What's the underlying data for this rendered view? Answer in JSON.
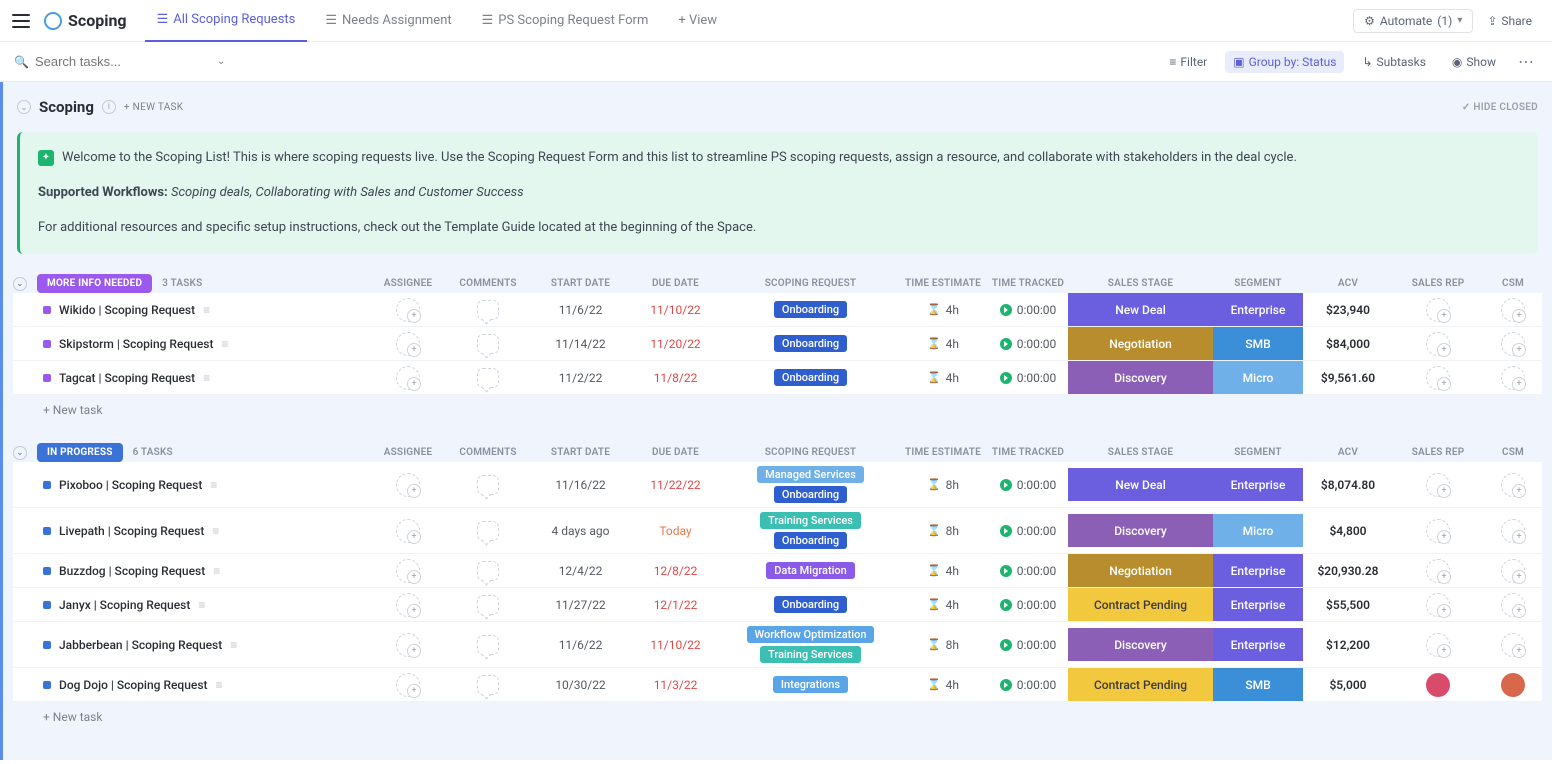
{
  "app": {
    "title": "Scoping",
    "tabs": [
      {
        "label": "All Scoping Requests",
        "active": true
      },
      {
        "label": "Needs Assignment"
      },
      {
        "label": "PS Scoping Request Form"
      }
    ],
    "add_view": "+ View",
    "automate": {
      "label": "Automate",
      "count": "(1)"
    },
    "share": "Share"
  },
  "filters": {
    "search_placeholder": "Search tasks...",
    "filter": "Filter",
    "group_by": "Group by: Status",
    "subtasks": "Subtasks",
    "show": "Show"
  },
  "section": {
    "title": "Scoping",
    "new_task": "+ NEW TASK",
    "hide_closed": "✓ HIDE CLOSED"
  },
  "banner": {
    "line1": "Welcome to the Scoping List! This is where scoping requests live. Use the Scoping Request Form and this list to streamline PS scoping requests, assign a resource, and collaborate with stakeholders in the deal cycle.",
    "supported_label": "Supported Workflows:",
    "supported_text": "Scoping deals, Collaborating with Sales and Customer Success",
    "line3": "For additional resources and specific setup instructions, check out the Template Guide located at the beginning of the Space."
  },
  "columns": [
    "ASSIGNEE",
    "COMMENTS",
    "START DATE",
    "DUE DATE",
    "SCOPING REQUEST",
    "TIME ESTIMATE",
    "TIME TRACKED",
    "SALES STAGE",
    "SEGMENT",
    "ACV",
    "SALES REP",
    "CSM"
  ],
  "colors": {
    "more_info": "#9b59ed",
    "in_progress": "#3a72d8",
    "tag_onboarding": "#2f5fcf",
    "tag_managed": "#6fb0e8",
    "tag_training": "#3bbfb3",
    "tag_datamig": "#8a5ae8",
    "tag_workflow": "#5aa5e8",
    "tag_integrations": "#5aa5e8",
    "stage_newdeal": "#6b5fe0",
    "stage_negotiation": "#b88d2e",
    "stage_discovery": "#8b5fb5",
    "stage_contract": "#f2c83e",
    "seg_enterprise": "#6b5fe0",
    "seg_smb": "#3a8fd8",
    "seg_micro": "#6fb0e8"
  },
  "groups": [
    {
      "status": "MORE INFO NEEDED",
      "count": "3 TASKS",
      "color_key": "more_info",
      "rows": [
        {
          "name": "Wikido | Scoping Request",
          "start": "11/6/22",
          "due": "11/10/22",
          "tags": [
            {
              "t": "Onboarding",
              "c": "tag_onboarding"
            }
          ],
          "est": "4h",
          "track": "0:00:00",
          "stage": {
            "t": "New Deal",
            "c": "stage_newdeal"
          },
          "seg": {
            "t": "Enterprise",
            "c": "seg_enterprise"
          },
          "acv": "$23,940"
        },
        {
          "name": "Skipstorm | Scoping Request",
          "start": "11/14/22",
          "due": "11/20/22",
          "tags": [
            {
              "t": "Onboarding",
              "c": "tag_onboarding"
            }
          ],
          "est": "4h",
          "track": "0:00:00",
          "stage": {
            "t": "Negotiation",
            "c": "stage_negotiation"
          },
          "seg": {
            "t": "SMB",
            "c": "seg_smb"
          },
          "acv": "$84,000"
        },
        {
          "name": "Tagcat | Scoping Request",
          "start": "11/2/22",
          "due": "11/8/22",
          "tags": [
            {
              "t": "Onboarding",
              "c": "tag_onboarding"
            }
          ],
          "est": "4h",
          "track": "0:00:00",
          "stage": {
            "t": "Discovery",
            "c": "stage_discovery"
          },
          "seg": {
            "t": "Micro",
            "c": "seg_micro"
          },
          "acv": "$9,561.60"
        }
      ]
    },
    {
      "status": "IN PROGRESS",
      "count": "6 TASKS",
      "color_key": "in_progress",
      "rows": [
        {
          "name": "Pixoboo | Scoping Request",
          "start": "11/16/22",
          "due": "11/22/22",
          "tags": [
            {
              "t": "Managed Services",
              "c": "tag_managed"
            },
            {
              "t": "Onboarding",
              "c": "tag_onboarding"
            }
          ],
          "est": "8h",
          "track": "0:00:00",
          "stage": {
            "t": "New Deal",
            "c": "stage_newdeal"
          },
          "seg": {
            "t": "Enterprise",
            "c": "seg_enterprise"
          },
          "acv": "$8,074.80"
        },
        {
          "name": "Livepath | Scoping Request",
          "start": "4 days ago",
          "due": "Today",
          "due_today": true,
          "tags": [
            {
              "t": "Training Services",
              "c": "tag_training"
            },
            {
              "t": "Onboarding",
              "c": "tag_onboarding"
            }
          ],
          "est": "8h",
          "track": "0:00:00",
          "stage": {
            "t": "Discovery",
            "c": "stage_discovery"
          },
          "seg": {
            "t": "Micro",
            "c": "seg_micro"
          },
          "acv": "$4,800"
        },
        {
          "name": "Buzzdog | Scoping Request",
          "start": "12/4/22",
          "due": "12/8/22",
          "tags": [
            {
              "t": "Data Migration",
              "c": "tag_datamig"
            }
          ],
          "est": "4h",
          "track": "0:00:00",
          "stage": {
            "t": "Negotiation",
            "c": "stage_negotiation"
          },
          "seg": {
            "t": "Enterprise",
            "c": "seg_enterprise"
          },
          "acv": "$20,930.28"
        },
        {
          "name": "Janyx | Scoping Request",
          "start": "11/27/22",
          "due": "12/1/22",
          "tags": [
            {
              "t": "Onboarding",
              "c": "tag_onboarding"
            }
          ],
          "est": "4h",
          "track": "0:00:00",
          "stage": {
            "t": "Contract Pending",
            "c": "stage_contract",
            "dark": true
          },
          "seg": {
            "t": "Enterprise",
            "c": "seg_enterprise"
          },
          "acv": "$55,500"
        },
        {
          "name": "Jabberbean | Scoping Request",
          "start": "11/6/22",
          "due": "11/10/22",
          "tags": [
            {
              "t": "Workflow Optimization",
              "c": "tag_workflow"
            },
            {
              "t": "Training Services",
              "c": "tag_training"
            }
          ],
          "est": "8h",
          "track": "0:00:00",
          "stage": {
            "t": "Discovery",
            "c": "stage_discovery"
          },
          "seg": {
            "t": "Enterprise",
            "c": "seg_enterprise"
          },
          "acv": "$12,200"
        },
        {
          "name": "Dog Dojo | Scoping Request",
          "start": "10/30/22",
          "due": "11/3/22",
          "tags": [
            {
              "t": "Integrations",
              "c": "tag_integrations"
            }
          ],
          "est": "4h",
          "track": "0:00:00",
          "stage": {
            "t": "Contract Pending",
            "c": "stage_contract",
            "dark": true
          },
          "seg": {
            "t": "SMB",
            "c": "seg_smb"
          },
          "acv": "$5,000",
          "rep_avatar": "#d84b6a",
          "csm_avatar": "#d8674b"
        }
      ]
    }
  ],
  "new_task_label": "+ New task"
}
